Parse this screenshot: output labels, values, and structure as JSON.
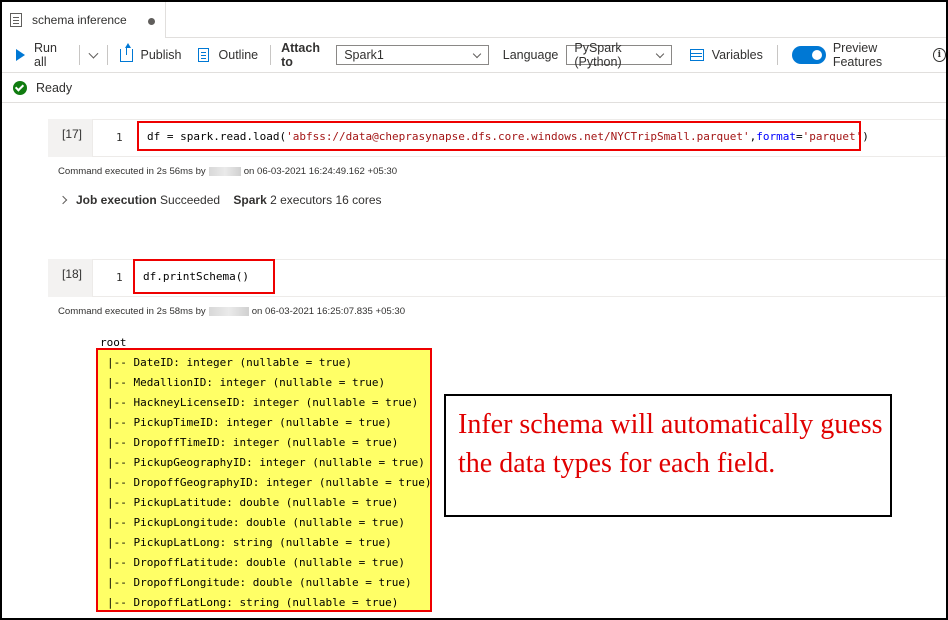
{
  "tab": {
    "title": "schema inference"
  },
  "toolbar": {
    "run_all": "Run all",
    "publish": "Publish",
    "outline": "Outline",
    "attach_to_label": "Attach to",
    "attach_to_value": "Spark1",
    "language_label": "Language",
    "language_value": "PySpark (Python)",
    "variables": "Variables",
    "preview_features": "Preview Features",
    "preview_features_enabled": true
  },
  "status": {
    "text": "Ready"
  },
  "cells": [
    {
      "index": "[17]",
      "line": "1",
      "code_prefix": "df = spark.read.load(",
      "code_string": "'abfss://data@cheprasynapse.dfs.core.windows.net/NYCTripSmall.parquet'",
      "code_sep": ", ",
      "code_kw": "format",
      "code_eq": "=",
      "code_string2": "'parquet'",
      "code_suffix": ")",
      "exec_prefix": "Command executed in 2s 56ms by",
      "exec_suffix": "on 06-03-2021 16:24:49.162 +05:30",
      "job_label": "Job execution",
      "job_status": "Succeeded",
      "spark_label": "Spark",
      "spark_detail": "2 executors 16 cores"
    },
    {
      "index": "[18]",
      "line": "1",
      "code": "df.printSchema()",
      "exec_prefix": "Command executed in 2s 58ms by",
      "exec_suffix": "on 06-03-2021 16:25:07.835 +05:30"
    }
  ],
  "schema": {
    "root": "root",
    "lines": [
      " |-- DateID: integer (nullable = true)",
      " |-- MedallionID: integer (nullable = true)",
      " |-- HackneyLicenseID: integer (nullable = true)",
      " |-- PickupTimeID: integer (nullable = true)",
      " |-- DropoffTimeID: integer (nullable = true)",
      " |-- PickupGeographyID: integer (nullable = true)",
      " |-- DropoffGeographyID: integer (nullable = true)",
      " |-- PickupLatitude: double (nullable = true)",
      " |-- PickupLongitude: double (nullable = true)",
      " |-- PickupLatLong: string (nullable = true)",
      " |-- DropoffLatitude: double (nullable = true)",
      " |-- DropoffLongitude: double (nullable = true)",
      " |-- DropoffLatLong: string (nullable = true)"
    ]
  },
  "callout": {
    "text": "Infer schema will automatically guess the data types for each field."
  },
  "colors": {
    "accent": "#0078d4",
    "highlight_border": "#ee0000",
    "schema_bg": "#ffff66",
    "callout_text": "#e00000",
    "success": "#107c10"
  }
}
